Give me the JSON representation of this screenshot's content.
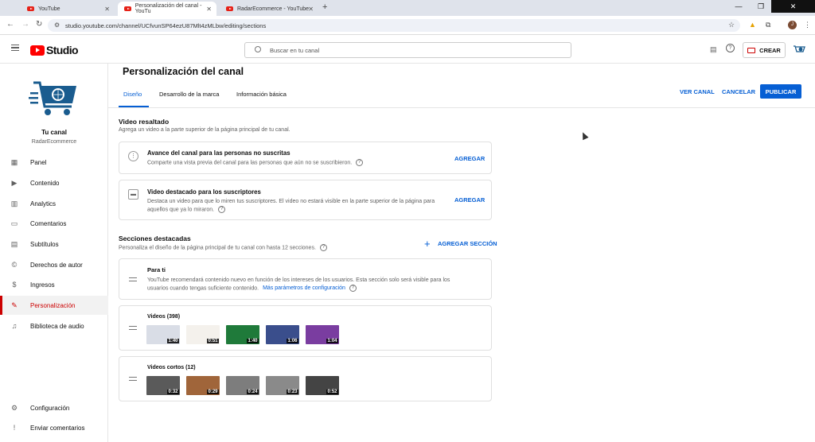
{
  "browser": {
    "tabs": [
      {
        "label": "YouTube"
      },
      {
        "label": "Personalización del canal - YouTu"
      },
      {
        "label": "RadarEcommerce - YouTube"
      }
    ],
    "url": "studio.youtube.com/channel/UCfvunSP64ezU87Mlt4zMLbw/editing/sections",
    "profile_initial": "J"
  },
  "header": {
    "logo_text": "Studio",
    "search_placeholder": "Buscar en tu canal",
    "create_label": "CREAR"
  },
  "sidebar": {
    "channel_name": "Tu canal",
    "channel_handle": "RadarEcommerce",
    "items": [
      {
        "label": "Panel",
        "icon": "dashboard-icon"
      },
      {
        "label": "Contenido",
        "icon": "content-icon"
      },
      {
        "label": "Analytics",
        "icon": "analytics-icon"
      },
      {
        "label": "Comentarios",
        "icon": "comments-icon"
      },
      {
        "label": "Subtítulos",
        "icon": "subtitles-icon"
      },
      {
        "label": "Derechos de autor",
        "icon": "copyright-icon"
      },
      {
        "label": "Ingresos",
        "icon": "dollar-icon"
      },
      {
        "label": "Personalización",
        "icon": "magic-wand-icon"
      },
      {
        "label": "Biblioteca de audio",
        "icon": "audio-library-icon"
      }
    ],
    "bottom_items": [
      {
        "label": "Configuración",
        "icon": "settings-icon"
      },
      {
        "label": "Enviar comentarios",
        "icon": "feedback-icon"
      }
    ]
  },
  "main": {
    "title": "Personalización del canal",
    "tabs": [
      {
        "label": "Diseño"
      },
      {
        "label": "Desarrollo de la marca"
      },
      {
        "label": "Información básica"
      }
    ],
    "actions": {
      "view_channel": "VER CANAL",
      "cancel": "CANCELAR",
      "publish": "PUBLICAR"
    },
    "featured_video": {
      "title": "Video resaltado",
      "description": "Agrega un video a la parte superior de la página principal de tu canal.",
      "cards": [
        {
          "title": "Avance del canal para las personas no suscritas",
          "description": "Comparte una vista previa del canal para las personas que aún no se suscribieron.",
          "action": "AGREGAR"
        },
        {
          "title": "Video destacado para los suscriptores",
          "description_line1": "Destaca un video para que lo miren tus suscriptores. El video no estará visible en la parte superior de la página para",
          "description_line2": "aquellos que ya lo miraron.",
          "action": "AGREGAR"
        }
      ]
    },
    "featured_sections": {
      "title": "Secciones destacadas",
      "description": "Personaliza el diseño de la página principal de tu canal con hasta 12 secciones.",
      "add_label": "AGREGAR SECCIÓN",
      "for_you": {
        "title": "Para ti",
        "description_line1": "YouTube recomendará contenido nuevo en función de los intereses de los usuarios. Esta sección solo será visible para los",
        "description_line2": "usuarios cuando tengas suficiente contenido.",
        "link": "Más parámetros de configuración"
      },
      "videos": {
        "title": "Videos (398)",
        "thumbs": [
          {
            "duration": "1:40",
            "color": "#d9dde6"
          },
          {
            "duration": "0:51",
            "color": "#f4f1ec"
          },
          {
            "duration": "1:40",
            "color": "#1f7a3a"
          },
          {
            "duration": "1:06",
            "color": "#3a4e8c"
          },
          {
            "duration": "1:04",
            "color": "#7a3da0"
          }
        ]
      },
      "shorts": {
        "title": "Videos cortos (12)",
        "thumbs": [
          {
            "duration": "0:32",
            "color": "#5a5a5a"
          },
          {
            "duration": "0:29",
            "color": "#a0653a"
          },
          {
            "duration": "0:24",
            "color": "#7d7d7d"
          },
          {
            "duration": "0:23",
            "color": "#8a8a8a"
          },
          {
            "duration": "0:52",
            "color": "#444444"
          }
        ]
      }
    }
  }
}
